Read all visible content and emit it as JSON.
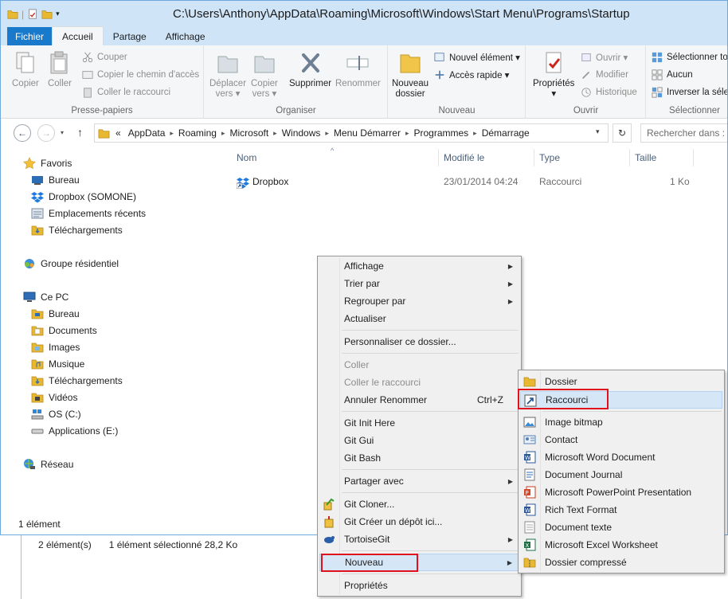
{
  "title_path": "C:\\Users\\Anthony\\AppData\\Roaming\\Microsoft\\Windows\\Start Menu\\Programs\\Startup",
  "tabs": [
    "Fichier",
    "Accueil",
    "Partage",
    "Affichage"
  ],
  "ribbon": {
    "presse_papiers": {
      "label": "Presse-papiers",
      "copier": "Copier",
      "coller": "Coller",
      "couper": "Couper",
      "copier_chemin": "Copier le chemin d'accès",
      "coller_raccourci": "Coller le raccourci"
    },
    "organiser": {
      "label": "Organiser",
      "deplacer_1": "Déplacer",
      "deplacer_2": "vers ▾",
      "copier_1": "Copier",
      "copier_2": "vers ▾",
      "supprimer": "Supprimer",
      "renommer": "Renommer"
    },
    "nouveau": {
      "label": "Nouveau",
      "nouveau_dossier_1": "Nouveau",
      "nouveau_dossier_2": "dossier",
      "nouvel_element": "Nouvel élément ▾",
      "acces_rapide": "Accès rapide ▾"
    },
    "ouvrir": {
      "label": "Ouvrir",
      "proprietes": "Propriétés",
      "ouvrir": "Ouvrir ▾",
      "modifier": "Modifier",
      "historique": "Historique"
    },
    "selectionner": {
      "label": "Sélectionner",
      "tout": "Sélectionner tout",
      "aucun": "Aucun",
      "inverser": "Inverser la sélection"
    }
  },
  "address": {
    "lead": "«",
    "crumbs": [
      "AppData",
      "Roaming",
      "Microsoft",
      "Windows",
      "Menu Démarrer",
      "Programmes",
      "Démarrage"
    ],
    "search_placeholder": "Rechercher dans : D"
  },
  "nav": {
    "favoris": "Favoris",
    "bureau": "Bureau",
    "dropbox": "Dropbox (SOMONE)",
    "emplacements": "Emplacements récents",
    "telechargements": "Téléchargements",
    "groupe": "Groupe résidentiel",
    "ce_pc": "Ce PC",
    "pc_bureau": "Bureau",
    "documents": "Documents",
    "images": "Images",
    "musique": "Musique",
    "pc_telechargements": "Téléchargements",
    "videos": "Vidéos",
    "os": "OS (C:)",
    "applications": "Applications (E:)",
    "reseau": "Réseau"
  },
  "columns": {
    "nom": "Nom",
    "modifie": "Modifié le",
    "type": "Type",
    "taille": "Taille"
  },
  "file": {
    "name": "Dropbox",
    "modified": "23/01/2014 04:24",
    "type": "Raccourci",
    "size": "1 Ko"
  },
  "status": {
    "count": "1 élément"
  },
  "bg_status": {
    "count": "2 élément(s)",
    "selected": "1 élément sélectionné  28,2 Ko"
  },
  "context_menu": {
    "affichage": "Affichage",
    "trier": "Trier par",
    "regrouper": "Regrouper par",
    "actualiser": "Actualiser",
    "personnaliser": "Personnaliser ce dossier...",
    "coller": "Coller",
    "coller_raccourci": "Coller le raccourci",
    "annuler": "Annuler Renommer",
    "annuler_shortcut": "Ctrl+Z",
    "git_init": "Git Init Here",
    "git_gui": "Git Gui",
    "git_bash": "Git Bash",
    "partager": "Partager avec",
    "git_cloner": "Git Cloner...",
    "git_creer": "Git Créer un dépôt ici...",
    "tortoisegit": "TortoiseGit",
    "nouveau": "Nouveau",
    "proprietes": "Propriétés"
  },
  "submenu": {
    "dossier": "Dossier",
    "raccourci": "Raccourci",
    "bitmap": "Image bitmap",
    "contact": "Contact",
    "word": "Microsoft Word Document",
    "journal": "Document Journal",
    "powerpoint": "Microsoft PowerPoint Presentation",
    "rtf": "Rich Text Format",
    "texte": "Document texte",
    "excel": "Microsoft Excel Worksheet",
    "compresse": "Dossier compressé"
  },
  "colors": {
    "accent": "#1979ca",
    "highlight": "#d5e6f7",
    "annotation": "#e0101c",
    "folder": "#e8b830"
  }
}
